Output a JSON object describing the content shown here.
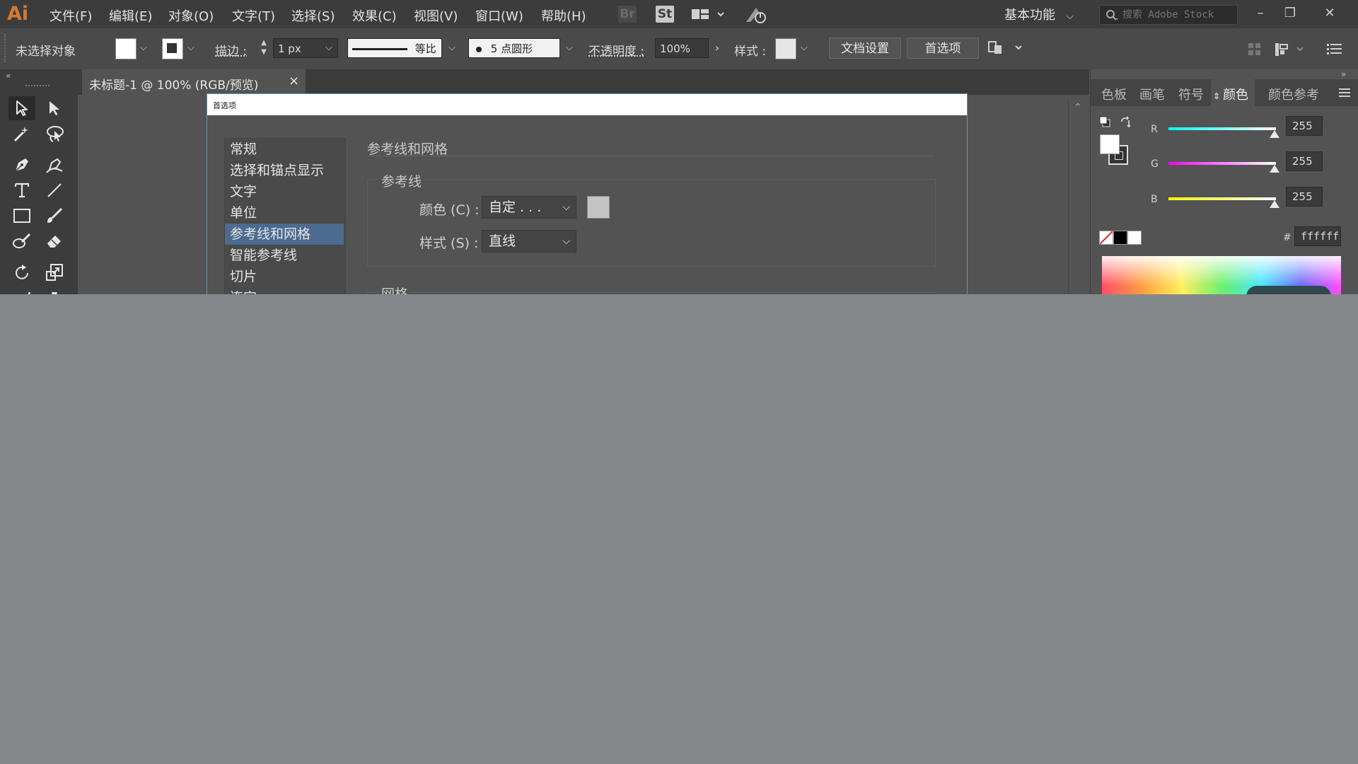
{
  "app": {
    "logo": "Ai"
  },
  "menu": {
    "items": [
      "文件(F)",
      "编辑(E)",
      "对象(O)",
      "文字(T)",
      "选择(S)",
      "效果(C)",
      "视图(V)",
      "窗口(W)",
      "帮助(H)"
    ],
    "bridge_icon": "Br",
    "stock_icon": "St",
    "workspace_label": "基本功能",
    "search_placeholder": "搜索 Adobe Stock"
  },
  "control_bar": {
    "selection_status": "未选择对象",
    "stroke_label": "描边 :",
    "stroke_weight": "1 px",
    "stroke_profile": "等比",
    "brush_label": "5 点圆形",
    "opacity_label": "不透明度 :",
    "opacity_value": "100%",
    "style_label": "样式 :",
    "doc_setup_button": "文档设置",
    "preferences_button": "首选项"
  },
  "document": {
    "tab_title": "未标题-1 @ 100% (RGB/预览)",
    "close_glyph": "×"
  },
  "dialog": {
    "title": "首选项",
    "categories": [
      "常规",
      "选择和锚点显示",
      "文字",
      "单位",
      "参考线和网格",
      "智能参考线",
      "切片",
      "连字"
    ],
    "selected_category": "参考线和网格",
    "section_heading": "参考线和网格",
    "guides": {
      "group_title": "参考线",
      "color_label": "颜色 (C) :",
      "color_value": "自定 . . .",
      "style_label": "样式 (S) :",
      "style_value": "直线"
    },
    "grid": {
      "group_title": "网格"
    }
  },
  "color_panel": {
    "tabs": [
      "色板",
      "画笔",
      "符号",
      "颜色",
      "颜色参考"
    ],
    "active_tab": "颜色",
    "channels": [
      {
        "label": "R",
        "value": "255"
      },
      {
        "label": "G",
        "value": "255"
      },
      {
        "label": "B",
        "value": "255"
      }
    ],
    "hex_label": "#",
    "hex_value": "ffffff"
  },
  "colors": {
    "menubar_bg": "#3c3c3c",
    "workspace_bg": "#535353",
    "selection_blue": "#4b6b8f",
    "logo_orange": "#d47a33",
    "desktop_gray": "#85888b"
  }
}
